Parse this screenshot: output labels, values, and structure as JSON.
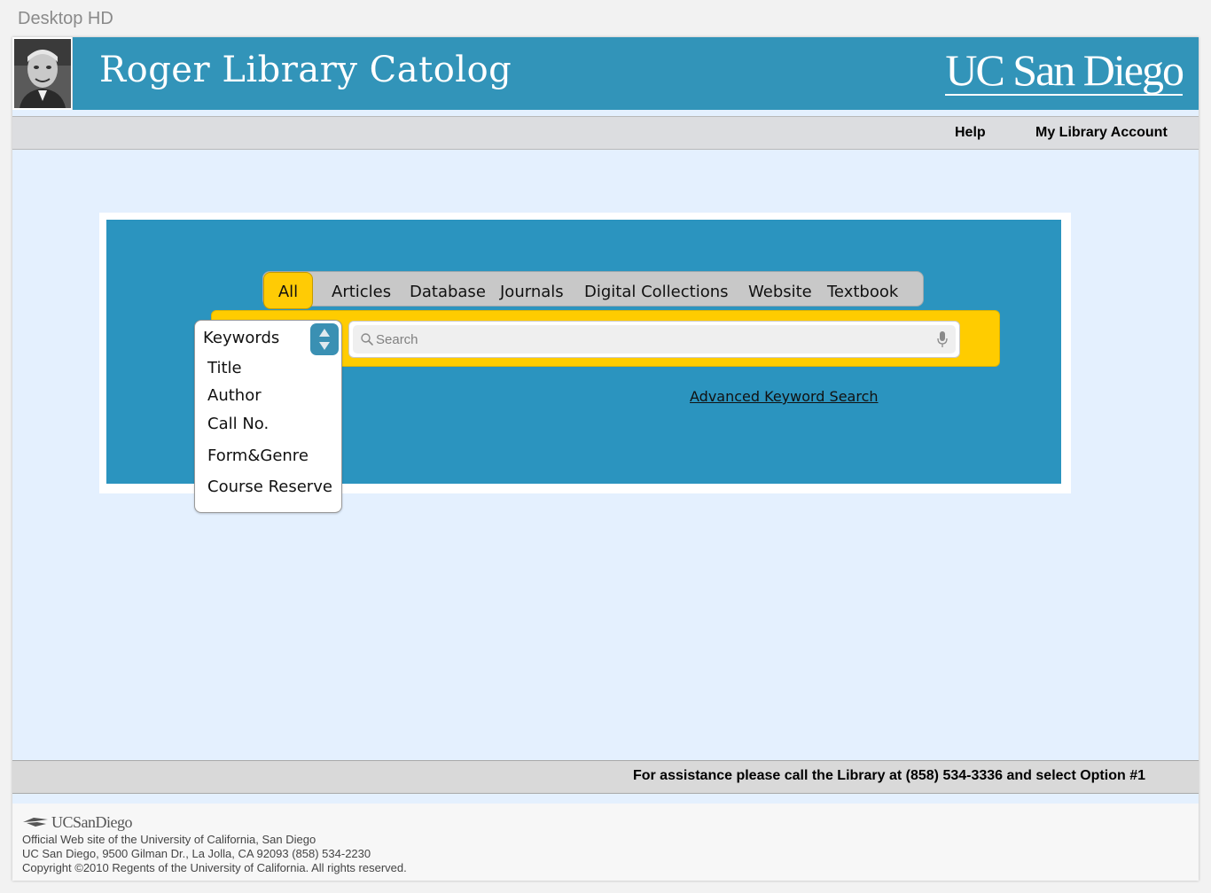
{
  "canvas": {
    "label": "Desktop HD"
  },
  "header": {
    "title": "Roger Library Catolog",
    "brand": "UC San Diego",
    "color": "#3294b9"
  },
  "nav": {
    "help": "Help",
    "account": "My Library Account"
  },
  "search": {
    "tabs": [
      "All",
      "Articles",
      "Database",
      "Journals",
      "Digital Collections",
      "Website",
      "Textbook"
    ],
    "active_tab": "All",
    "placeholder": "Search",
    "advanced_link": "Advanced Keyword Search",
    "accent_color": "#ffcc00"
  },
  "search_type": {
    "selected": "Keywords",
    "options": [
      "Title",
      "Author",
      "Call No.",
      "Form&Genre",
      "Course Reserve"
    ]
  },
  "assistance": {
    "text": "For assistance please call the Library at (858) 534-3336 and select Option #1"
  },
  "footer": {
    "logo_text": "UCSanDiego",
    "line1": "Official Web site of the University of California, San Diego",
    "line2": "UC San Diego, 9500 Gilman Dr., La Jolla, CA 92093 (858) 534-2230",
    "line3": "Copyright ©2010 Regents of the University of California. All rights reserved."
  },
  "icons": [
    "portrait-photo",
    "search-icon",
    "microphone-icon",
    "stepper-arrows-icon",
    "ucsd-triton-logo-icon"
  ]
}
